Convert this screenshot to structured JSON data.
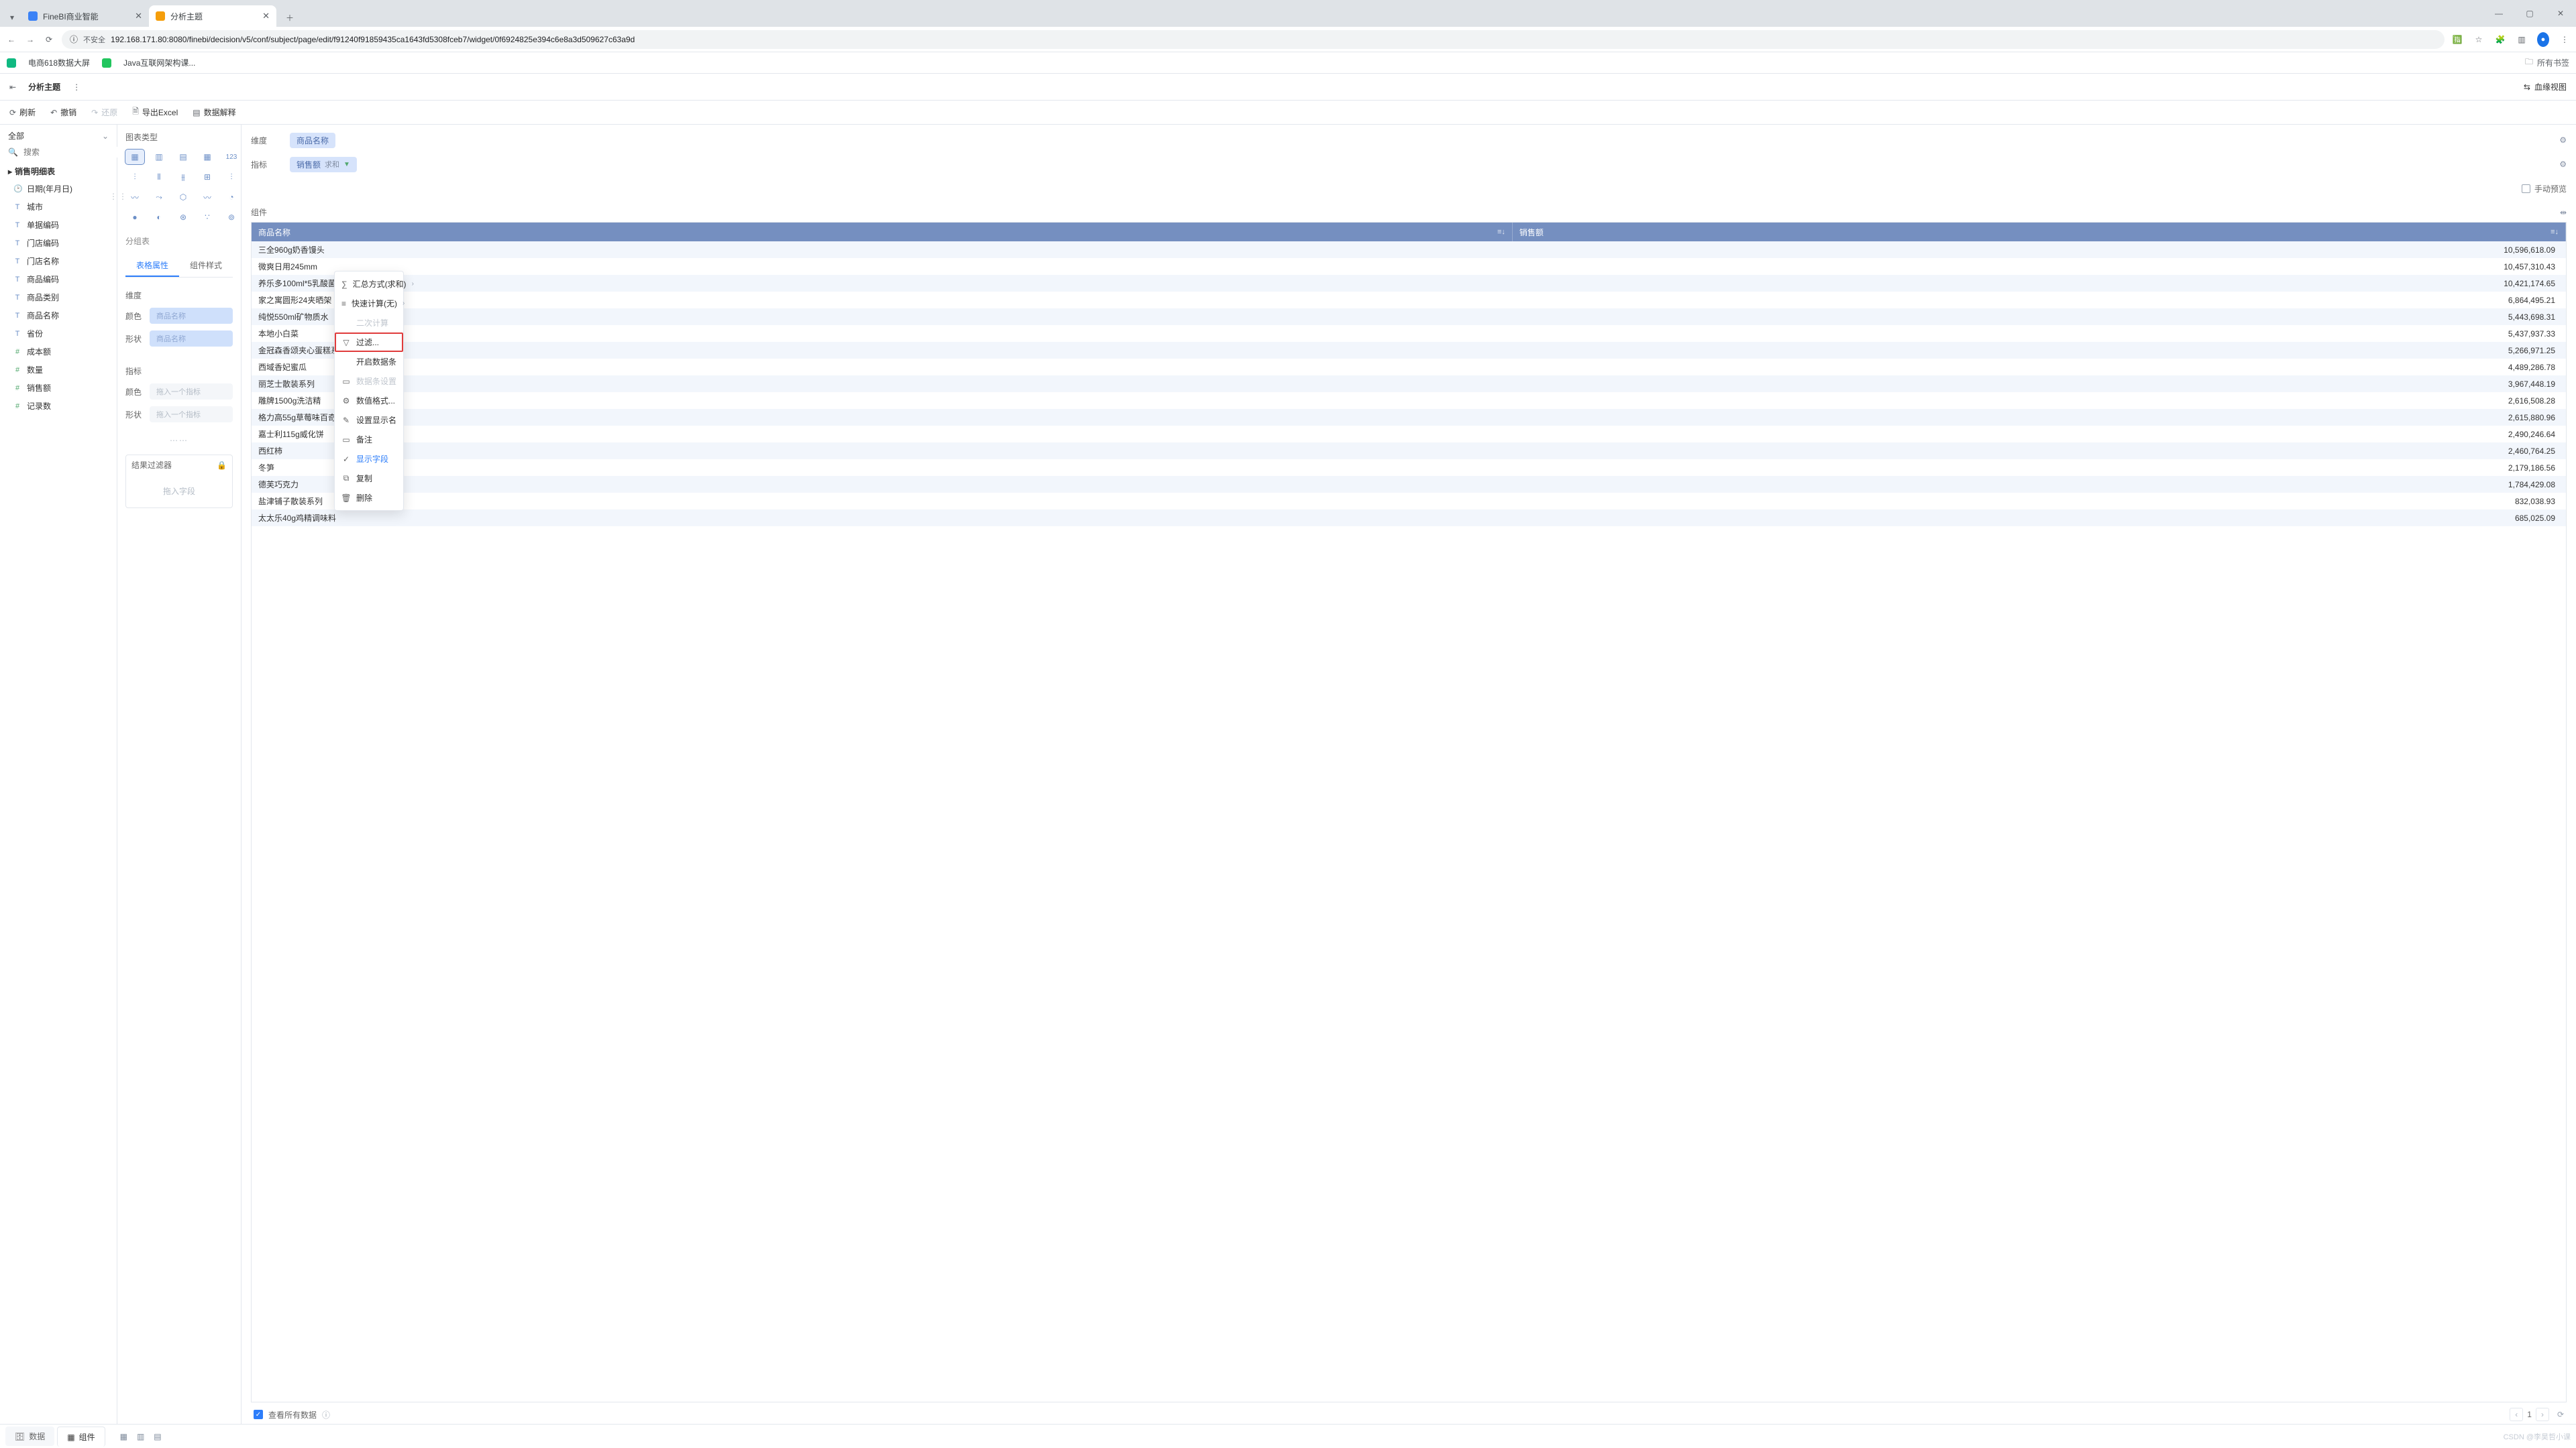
{
  "browser": {
    "tabs": [
      {
        "title": "FineBI商业智能",
        "fav_color": "#3b82f6"
      },
      {
        "title": "分析主题",
        "fav_color": "#f59e0b"
      }
    ],
    "insecure_label": "不安全",
    "url": "192.168.171.80:8080/finebi/decision/v5/conf/subject/page/edit/f91240f91859435ca1643fd5308fceb7/widget/0f6924825e394c6e8a3d509627c63a9d",
    "bookmarks": [
      {
        "label": "电商618数据大屏",
        "fav_color": "#10b981"
      },
      {
        "label": "Java互联网架构课...",
        "fav_color": "#22c55e"
      }
    ],
    "all_bookmarks": "所有书签"
  },
  "app": {
    "back_tooltip": "返回",
    "title": "分析主题",
    "lineage": "血缘视图"
  },
  "toolbar": {
    "refresh": "刷新",
    "undo": "撤销",
    "redo": "还原",
    "export": "导出Excel",
    "explain": "数据解释"
  },
  "left": {
    "all": "全部",
    "search_placeholder": "搜索",
    "table": "销售明细表",
    "fields": [
      {
        "icon": "clock",
        "label": "日期(年月日)",
        "cls": "date"
      },
      {
        "icon": "T",
        "label": "城市"
      },
      {
        "icon": "T",
        "label": "单据编码"
      },
      {
        "icon": "T",
        "label": "门店编码"
      },
      {
        "icon": "T",
        "label": "门店名称"
      },
      {
        "icon": "T",
        "label": "商品编码"
      },
      {
        "icon": "T",
        "label": "商品类别"
      },
      {
        "icon": "T",
        "label": "商品名称"
      },
      {
        "icon": "T",
        "label": "省份"
      },
      {
        "icon": "#",
        "label": "成本额",
        "cls": "num"
      },
      {
        "icon": "#",
        "label": "数量",
        "cls": "num"
      },
      {
        "icon": "#",
        "label": "销售额",
        "cls": "num"
      },
      {
        "icon": "#",
        "label": "记录数",
        "cls": "num"
      }
    ]
  },
  "mid": {
    "chart_type": "图表类型",
    "group_table": "分组表",
    "tab_attr": "表格属性",
    "tab_style": "组件样式",
    "dim_title": "维度",
    "ind_title": "指标",
    "color": "颜色",
    "shape": "形状",
    "dim_chip": "商品名称",
    "ind_placeholder": "拖入一个指标",
    "filter_title": "结果过滤器",
    "filter_placeholder": "拖入字段",
    "chart_num_label": "123"
  },
  "main": {
    "dim_label": "维度",
    "ind_label": "指标",
    "comp_label": "组件",
    "dim_pill": "商品名称",
    "ind_pill": "销售额",
    "ind_sum": "求和",
    "manual_preview": "手动预览",
    "col_name": "商品名称",
    "col_val": "销售额",
    "rows": [
      {
        "name": "三全960g奶香馒头",
        "val": "10,596,618.09"
      },
      {
        "name": "微爽日用245mm",
        "val": "10,457,310.43"
      },
      {
        "name": "养乐多100ml*5乳酸菌",
        "val": "10,421,174.65"
      },
      {
        "name": "家之寓圆形24夹晒架",
        "val": "6,864,495.21"
      },
      {
        "name": "纯悦550ml矿物质水",
        "val": "5,443,698.31"
      },
      {
        "name": "本地小白菜",
        "val": "5,437,937.33"
      },
      {
        "name": "金冠森香颂夹心蛋糕系列",
        "val": "5,266,971.25"
      },
      {
        "name": "西域香妃蜜瓜",
        "val": "4,489,286.78"
      },
      {
        "name": "丽芝士散装系列",
        "val": "3,967,448.19"
      },
      {
        "name": "雕牌1500g洗洁精",
        "val": "2,616,508.28"
      },
      {
        "name": "格力高55g草莓味百奇",
        "val": "2,615,880.96"
      },
      {
        "name": "嘉士利115g威化饼",
        "val": "2,490,246.64"
      },
      {
        "name": "西红柿",
        "val": "2,460,764.25"
      },
      {
        "name": "冬笋",
        "val": "2,179,186.56"
      },
      {
        "name": "德芙巧克力",
        "val": "1,784,429.08"
      },
      {
        "name": "盐津铺子散装系列",
        "val": "832,038.93"
      },
      {
        "name": "太太乐40g鸡精调味料",
        "val": "685,025.09"
      }
    ],
    "view_all": "查看所有数据",
    "page": "1"
  },
  "menu": {
    "items": [
      {
        "key": "agg",
        "label": "汇总方式(求和)",
        "icon": "∑",
        "arrow": true
      },
      {
        "key": "quick",
        "label": "快速计算(无)",
        "icon": "≡",
        "arrow": true
      },
      {
        "key": "secondary",
        "label": "二次计算",
        "icon": "",
        "disabled": true
      },
      {
        "key": "filter",
        "label": "过滤...",
        "icon": "▽",
        "hl": true
      },
      {
        "key": "databar",
        "label": "开启数据条",
        "icon": ""
      },
      {
        "key": "barcfg",
        "label": "数据条设置",
        "icon": "▭",
        "disabled": true
      },
      {
        "key": "numfmt",
        "label": "数值格式...",
        "icon": "⚙"
      },
      {
        "key": "dispname",
        "label": "设置显示名",
        "icon": "✎"
      },
      {
        "key": "note",
        "label": "备注",
        "icon": "▭"
      },
      {
        "key": "showfield",
        "label": "显示字段",
        "icon": "✓",
        "checked": true
      },
      {
        "key": "copy",
        "label": "复制",
        "icon": "⧉"
      },
      {
        "key": "delete",
        "label": "删除",
        "icon": "🗑"
      }
    ]
  },
  "bottom": {
    "data": "数据",
    "component": "组件",
    "watermark": "CSDN @李昊哲小课"
  }
}
